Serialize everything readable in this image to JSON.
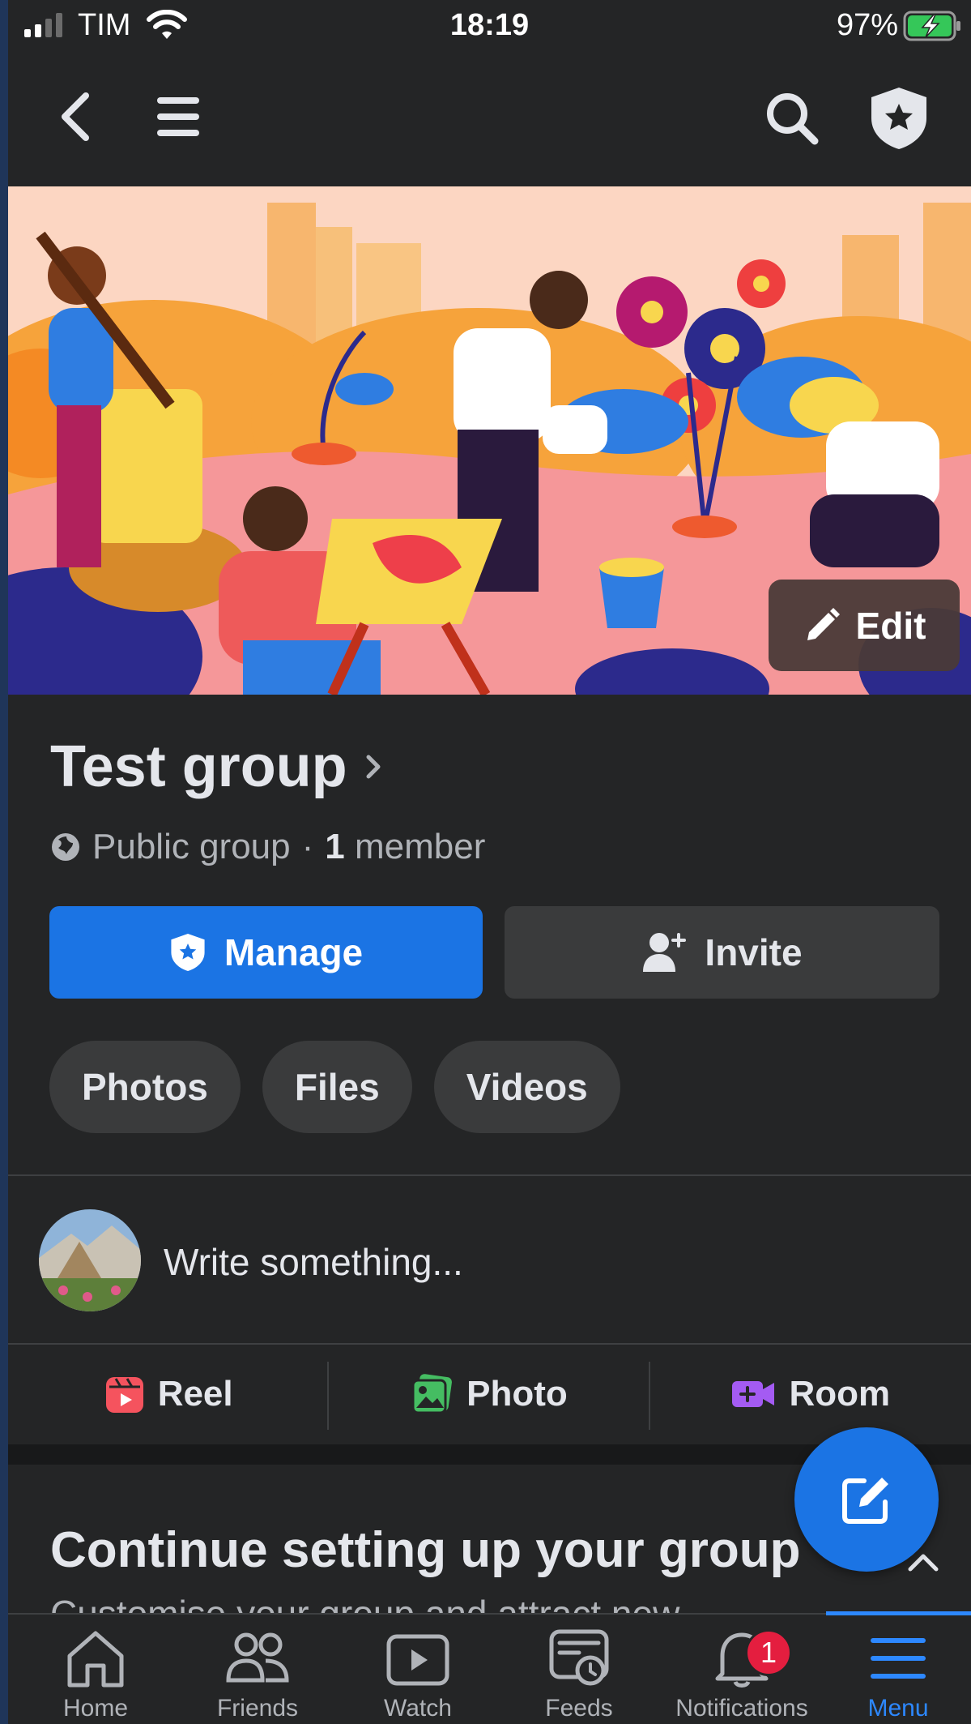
{
  "status_bar": {
    "carrier": "TIM",
    "time": "18:19",
    "battery": "97%"
  },
  "group": {
    "name": "Test group",
    "privacy": "Public group",
    "separator": "·",
    "member_count": "1",
    "member_label": "member"
  },
  "cover": {
    "edit_label": "Edit"
  },
  "buttons": {
    "manage": "Manage",
    "invite": "Invite"
  },
  "chips": [
    "Photos",
    "Files",
    "Videos"
  ],
  "composer": {
    "placeholder": "Write something..."
  },
  "post_actions": [
    "Reel",
    "Photo",
    "Room"
  ],
  "setup": {
    "title": "Continue setting up your group",
    "subtitle": "Customise your group and attract new"
  },
  "tabs": [
    {
      "label": "Home"
    },
    {
      "label": "Friends"
    },
    {
      "label": "Watch"
    },
    {
      "label": "Feeds"
    },
    {
      "label": "Notifications",
      "badge": "1"
    },
    {
      "label": "Menu",
      "active": true
    }
  ],
  "colors": {
    "accent": "#1b74e4",
    "badge": "#e41e3f",
    "background": "#242526"
  }
}
